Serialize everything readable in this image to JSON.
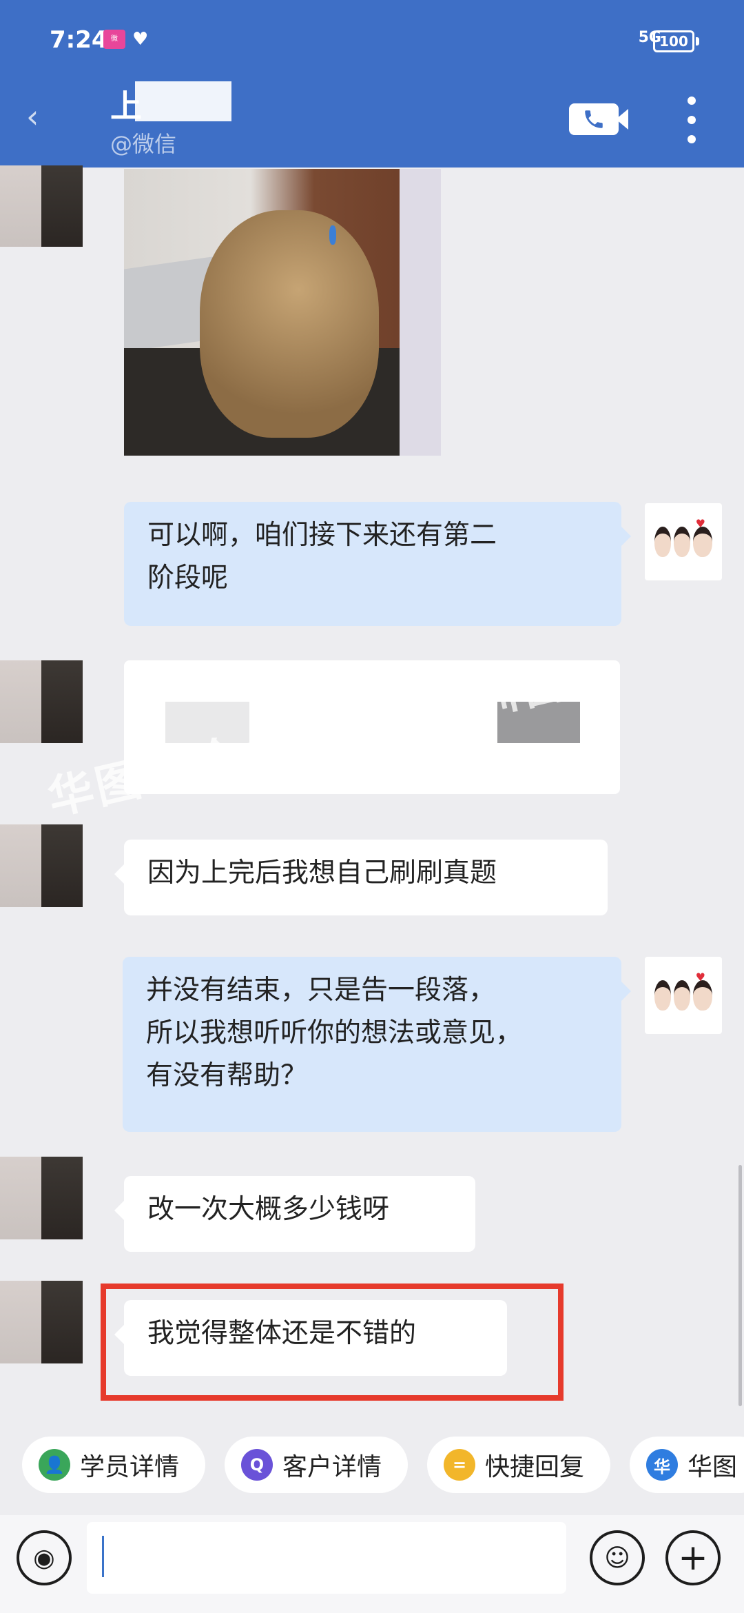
{
  "status_bar": {
    "time": "7:24",
    "signal": "5G",
    "battery": "100"
  },
  "header": {
    "title": "上",
    "subtitle": "@微信"
  },
  "messages": [
    {
      "dir": "out",
      "text_lines": [
        "可以啊，咱们接下来还有第二",
        "阶段呢"
      ]
    },
    {
      "dir": "in",
      "text": "因为上完后我想自己刷刷真题"
    },
    {
      "dir": "out",
      "text_lines": [
        "并没有结束，只是告一段落，",
        "所以我想听听你的想法或意见，",
        "有没有帮助？"
      ]
    },
    {
      "dir": "in",
      "text": "改一次大概多少钱呀"
    },
    {
      "dir": "in",
      "text": "我觉得整体还是不错的"
    }
  ],
  "watermark": "华图申论大咖提分集训营",
  "quick_actions": [
    {
      "label": "学员详情",
      "icon": "person-icon",
      "color": "#3aa65a"
    },
    {
      "label": "客户详情",
      "icon": "customer-icon",
      "color": "#6a52d8"
    },
    {
      "label": "快捷回复",
      "icon": "quick-reply-icon",
      "color": "#f2b62a"
    },
    {
      "label": "华图",
      "icon": "huatu-icon",
      "color": "#2f7de0"
    }
  ],
  "input": {
    "placeholder": ""
  },
  "colors": {
    "header": "#3e6fc6",
    "bubble_out": "#d7e7fb",
    "bubble_in": "#ffffff",
    "highlight": "#e63a2c"
  }
}
